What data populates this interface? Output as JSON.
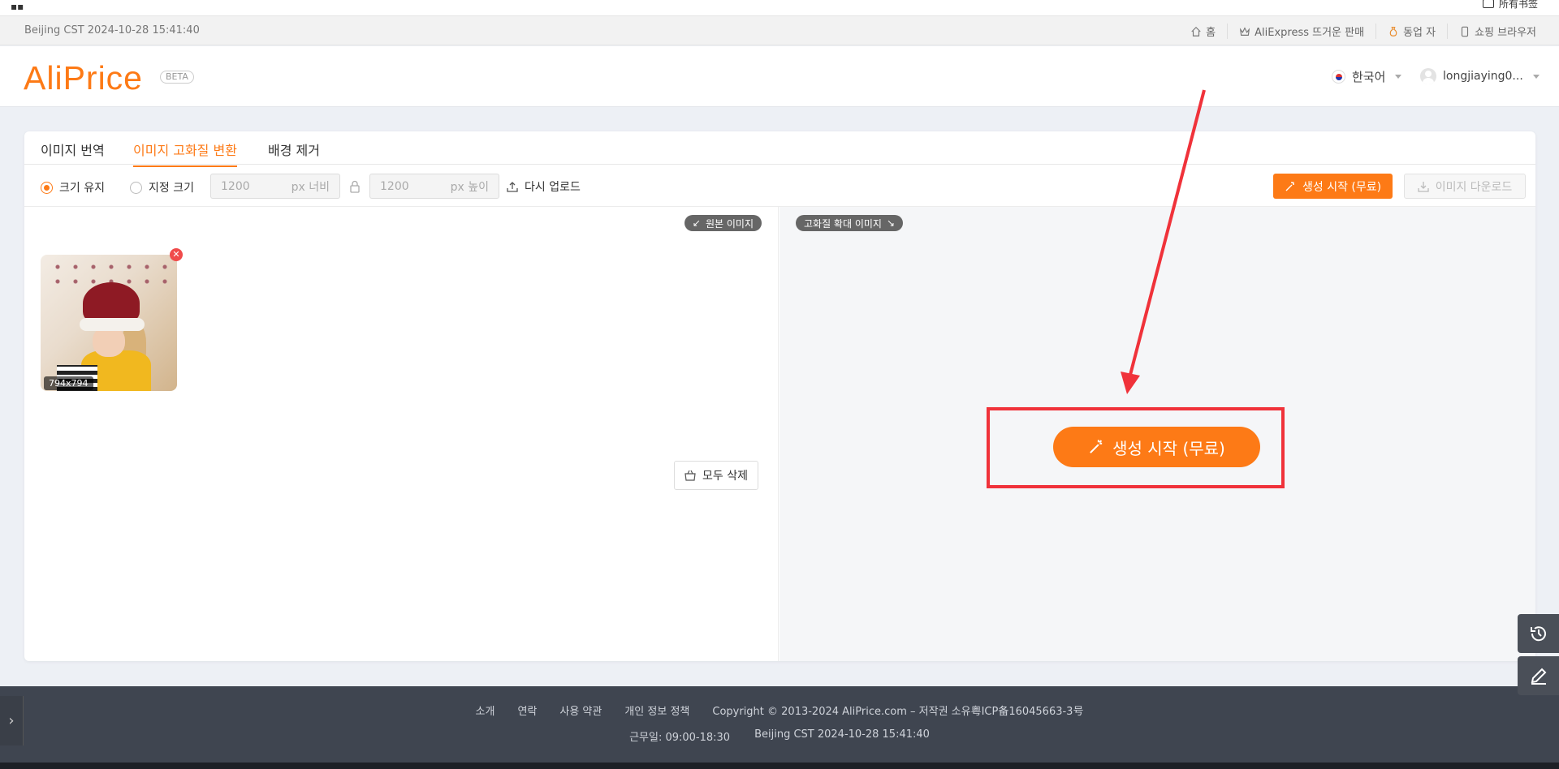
{
  "browser": {
    "bookmark_label": "所有书签"
  },
  "topbar": {
    "time": "Beijing CST  2024-10-28 15:41:40",
    "nav": [
      "홈",
      "AliExpress 뜨거운 판매",
      "동업 자",
      "쇼핑 브라우저"
    ]
  },
  "header": {
    "logo": "AliPrice",
    "beta": "BETA",
    "language": "한국어",
    "username": "longjiaying0..."
  },
  "tabs": [
    "이미지 번역",
    "이미지 고화질 변환",
    "배경 제거"
  ],
  "options": {
    "keep_size": "크기 유지",
    "custom_size": "지정 크기",
    "width_value": "1200",
    "width_unit": "px 너비",
    "height_value": "1200",
    "height_unit": "px 높이",
    "reupload": "다시 업로드",
    "generate": "생성 시작 (무료)",
    "download": "이미지 다운로드"
  },
  "left_panel": {
    "badge": "원본 이미지",
    "image_size": "794x794",
    "clear_all": "모두 삭제"
  },
  "right_panel": {
    "badge": "고화질 확대 이미지",
    "generate_big": "생성 시작 (무료)"
  },
  "footer": {
    "links": [
      "소개",
      "연락",
      "사용 약관",
      "개인 정보 정책"
    ],
    "copyright": "Copyright © 2013-2024 AliPrice.com – 저작권 소유粤ICP备16045663-3号",
    "hours": "근무일: 09:00-18:30",
    "time": "Beijing CST  2024-10-28 15:41:40"
  },
  "colors": {
    "accent": "#fd7a16",
    "highlight": "#f0323a"
  }
}
